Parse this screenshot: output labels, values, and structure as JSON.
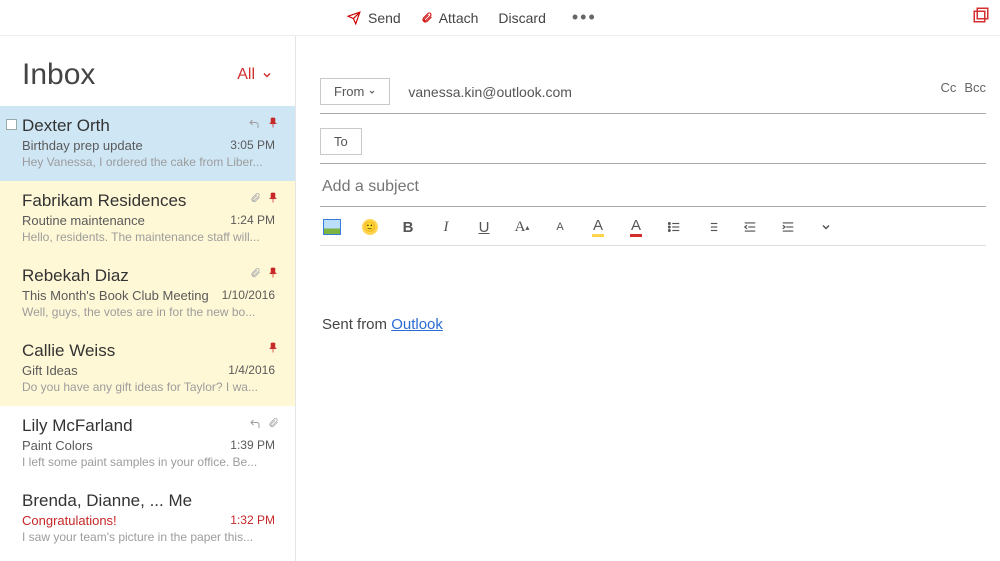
{
  "toolbar": {
    "send_label": "Send",
    "attach_label": "Attach",
    "discard_label": "Discard"
  },
  "inbox": {
    "title": "Inbox",
    "filter_label": "All"
  },
  "messages": [
    {
      "sender": "Dexter Orth",
      "subject": "Birthday prep update",
      "time": "3:05 PM",
      "preview": "Hey Vanessa, I ordered the cake from Liber...",
      "selected": true,
      "flagged": false,
      "pin": true,
      "reply": true,
      "clip": false,
      "subject_red": false,
      "time_red": false,
      "checkbox": true
    },
    {
      "sender": "Fabrikam Residences",
      "subject": "Routine maintenance",
      "time": "1:24 PM",
      "preview": "Hello, residents. The maintenance staff will...",
      "selected": false,
      "flagged": true,
      "pin": true,
      "reply": false,
      "clip": true,
      "subject_red": false,
      "time_red": false,
      "checkbox": false
    },
    {
      "sender": "Rebekah Diaz",
      "subject": "This Month's Book Club Meeting",
      "time": "1/10/2016",
      "preview": "Well, guys, the votes are in for the new bo...",
      "selected": false,
      "flagged": true,
      "pin": true,
      "reply": false,
      "clip": true,
      "subject_red": false,
      "time_red": false,
      "checkbox": false
    },
    {
      "sender": "Callie Weiss",
      "subject": "Gift Ideas",
      "time": "1/4/2016",
      "preview": "Do you have any gift ideas for Taylor? I wa...",
      "selected": false,
      "flagged": true,
      "pin": true,
      "reply": false,
      "clip": false,
      "subject_red": false,
      "time_red": false,
      "checkbox": false
    },
    {
      "sender": "Lily McFarland",
      "subject": "Paint Colors",
      "time": "1:39 PM",
      "preview": "I left some paint samples in your office. Be...",
      "selected": false,
      "flagged": false,
      "pin": false,
      "reply": true,
      "clip": true,
      "subject_red": false,
      "time_red": false,
      "checkbox": false
    },
    {
      "sender": "Brenda, Dianne, ... Me",
      "subject": "Congratulations!",
      "time": "1:32 PM",
      "preview": "I saw your team's picture in the paper this...",
      "selected": false,
      "flagged": false,
      "pin": false,
      "reply": false,
      "clip": false,
      "subject_red": true,
      "time_red": true,
      "checkbox": false
    }
  ],
  "compose": {
    "from_label": "From",
    "from_value": "vanessa.kin@outlook.com",
    "to_label": "To",
    "cc_label": "Cc",
    "bcc_label": "Bcc",
    "subject_placeholder": "Add a subject",
    "signature_prefix": "Sent from ",
    "signature_link": "Outlook"
  },
  "format": {
    "bold": "B",
    "italic": "I",
    "underline": "U"
  }
}
